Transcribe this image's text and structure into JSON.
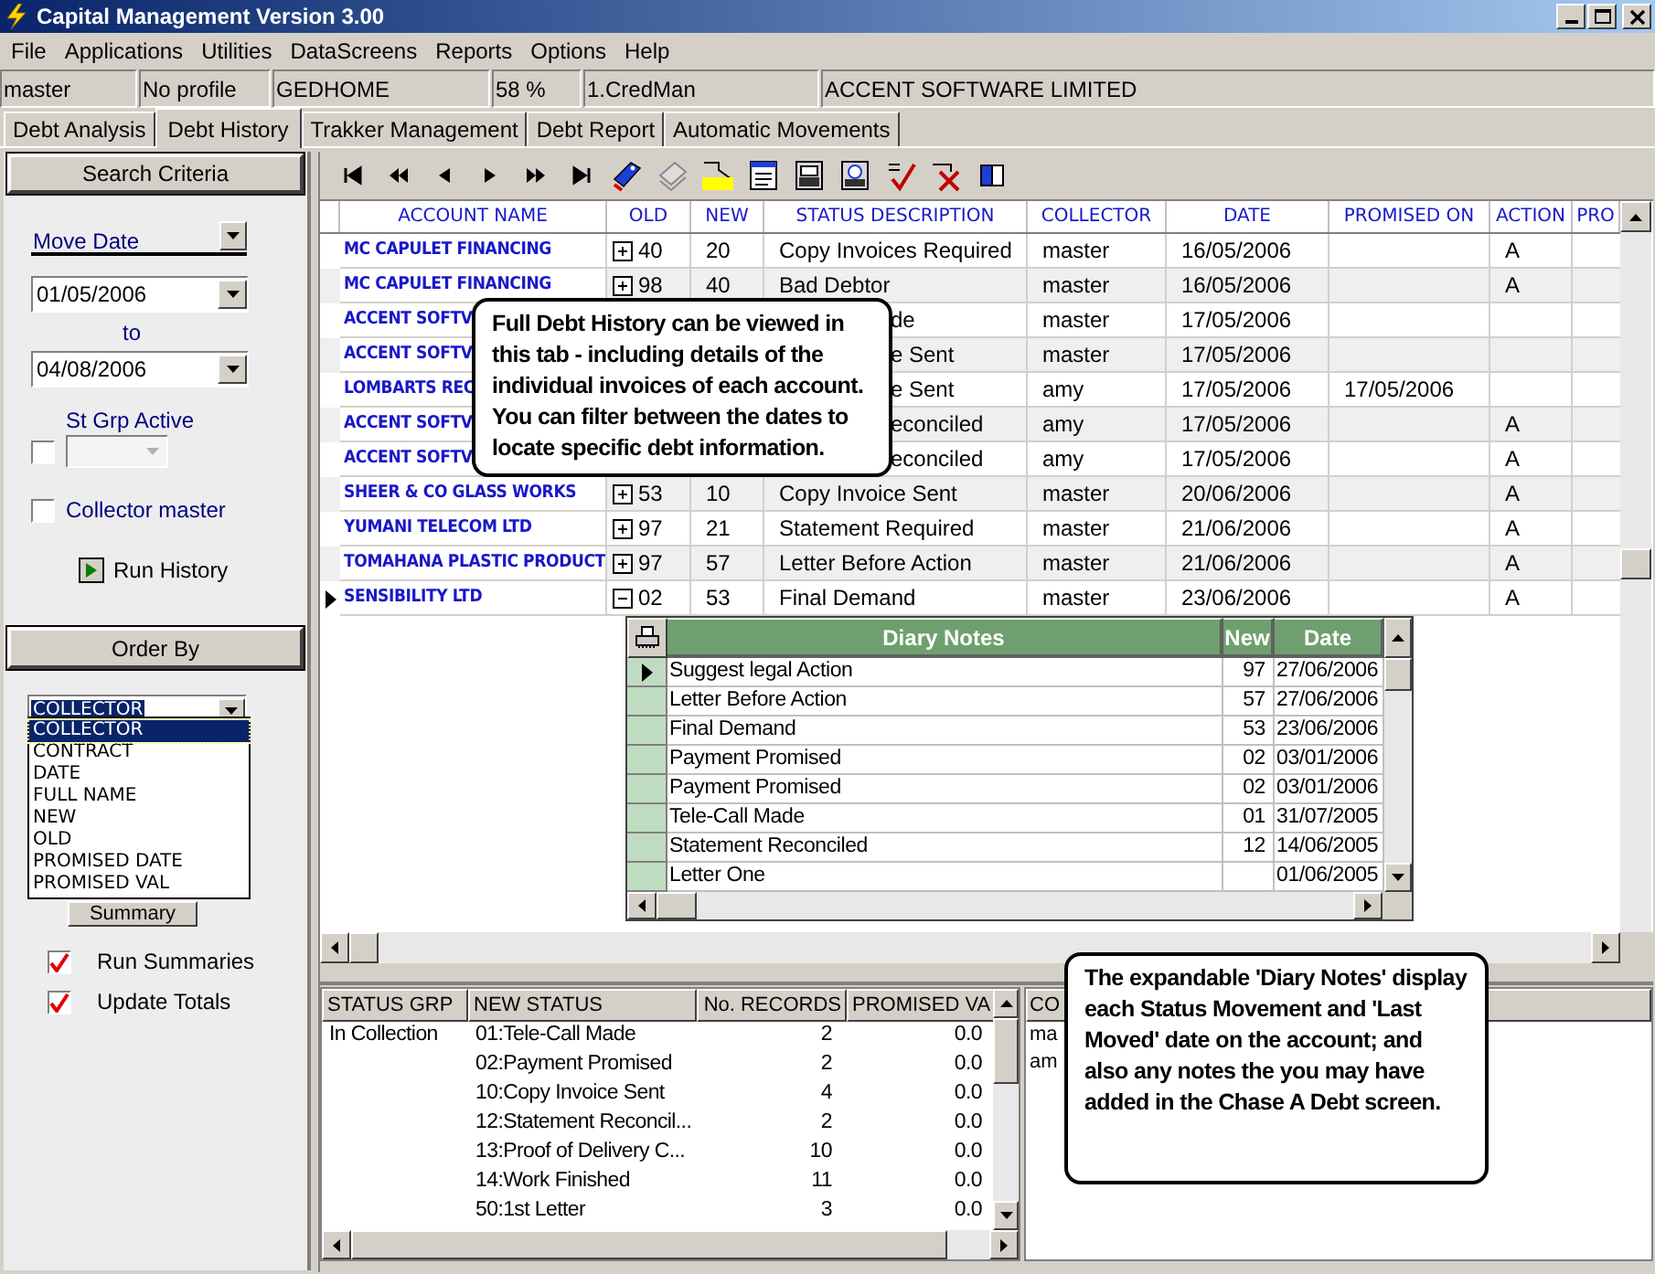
{
  "window": {
    "title": "Capital Management Version 3.00"
  },
  "menu": [
    "File",
    "Applications",
    "Utilities",
    "DataScreens",
    "Reports",
    "Options",
    "Help"
  ],
  "status_cells": [
    "master",
    "No profile",
    "GEDHOME",
    "58 %",
    "1.CredMan",
    "ACCENT SOFTWARE LIMITED"
  ],
  "tabs": [
    {
      "label": "Debt Analysis",
      "selected": false
    },
    {
      "label": "Debt History",
      "selected": true
    },
    {
      "label": "Trakker Management",
      "selected": false
    },
    {
      "label": "Debt Report",
      "selected": false
    },
    {
      "label": "Automatic Movements",
      "selected": false
    }
  ],
  "search_panel": {
    "title": "Search Criteria",
    "date_field": "Move Date",
    "from": "01/05/2006",
    "to_label": "to",
    "to": "04/08/2006",
    "status_group_label": "St Grp Active",
    "status_group_checked": false,
    "collector_label": "Collector master",
    "collector_checked": false,
    "run_button": "Run History"
  },
  "order_panel": {
    "title": "Order By",
    "value": "COLLECTOR",
    "options": [
      {
        "label": "COLLECTOR",
        "selected": true
      },
      {
        "label": "CONTRACT",
        "selected": false
      },
      {
        "label": "DATE",
        "selected": false
      },
      {
        "label": "FULL NAME",
        "selected": false
      },
      {
        "label": "NEW",
        "selected": false
      },
      {
        "label": "OLD",
        "selected": false
      },
      {
        "label": "PROMISED DATE",
        "selected": false
      },
      {
        "label": "PROMISED VAL",
        "selected": false
      }
    ],
    "summary_button": "Summary",
    "checks": [
      {
        "label": "Run Summaries",
        "checked": true
      },
      {
        "label": "Update Totals",
        "checked": true
      }
    ]
  },
  "grid": {
    "columns": [
      "ACCOUNT NAME",
      "OLD",
      "NEW",
      "STATUS DESCRIPTION",
      "COLLECTOR",
      "DATE",
      "PROMISED ON",
      "ACTION",
      "PRO"
    ],
    "rows": [
      {
        "kind": "full",
        "selected": false,
        "expanded": false,
        "account": "MC CAPULET FINANCING",
        "old": "40",
        "new": "20",
        "status": "Copy Invoices Required",
        "collector": "master",
        "date": "16/05/2006",
        "action": "A"
      },
      {
        "kind": "full",
        "selected": false,
        "expanded": false,
        "account": "MC CAPULET FINANCING",
        "old": "98",
        "new": "40",
        "status": "Bad Debtor",
        "collector": "master",
        "date": "16/05/2006",
        "action": "A"
      },
      {
        "kind": "covered",
        "selected": false,
        "account": "ACCENT SOFTV",
        "status": "de",
        "collector": "master",
        "date": "17/05/2006"
      },
      {
        "kind": "covered",
        "selected": false,
        "account": "ACCENT SOFTV",
        "status": "e Sent",
        "collector": "master",
        "date": "17/05/2006"
      },
      {
        "kind": "covered",
        "selected": false,
        "account": "LOMBARTS REC",
        "status": "e Sent",
        "collector": "amy",
        "date": "17/05/2006",
        "promised_on": "17/05/2006"
      },
      {
        "kind": "covered",
        "selected": false,
        "account": "ACCENT SOFTV",
        "status": "econciled",
        "collector": "amy",
        "date": "17/05/2006",
        "action": "A"
      },
      {
        "kind": "covered",
        "selected": false,
        "account": "ACCENT SOFTV",
        "status": "econciled",
        "collector": "amy",
        "date": "17/05/2006",
        "action": "A"
      },
      {
        "kind": "full",
        "selected": false,
        "expanded": false,
        "account": "SHEER & CO GLASS WORKS",
        "old": "53",
        "new": "10",
        "status": "Copy Invoice Sent",
        "collector": "master",
        "date": "20/06/2006",
        "action": "A"
      },
      {
        "kind": "full",
        "selected": false,
        "expanded": false,
        "account": "YUMANI TELECOM LTD",
        "old": "97",
        "new": "21",
        "status": "Statement Required",
        "collector": "master",
        "date": "21/06/2006",
        "action": "A"
      },
      {
        "kind": "full",
        "selected": false,
        "expanded": false,
        "account": "TOMAHANA PLASTIC PRODUCT",
        "old": "97",
        "new": "57",
        "status": "Letter Before Action",
        "collector": "master",
        "date": "21/06/2006",
        "action": "A"
      },
      {
        "kind": "full",
        "selected": true,
        "expanded": true,
        "account": "SENSIBILITY LTD",
        "old": "02",
        "new": "53",
        "status": "Final Demand",
        "collector": "master",
        "date": "23/06/2006",
        "action": "A"
      }
    ],
    "diary": {
      "columns": [
        "Diary Notes",
        "New",
        "Date"
      ],
      "rows": [
        {
          "selected": true,
          "note": "Suggest legal Action",
          "new": "97",
          "date": "27/06/2006"
        },
        {
          "selected": false,
          "note": "Letter Before Action",
          "new": "57",
          "date": "27/06/2006"
        },
        {
          "selected": false,
          "note": "Final Demand",
          "new": "53",
          "date": "23/06/2006"
        },
        {
          "selected": false,
          "note": "Payment Promised",
          "new": "02",
          "date": "03/01/2006"
        },
        {
          "selected": false,
          "note": "Payment Promised",
          "new": "02",
          "date": "03/01/2006"
        },
        {
          "selected": false,
          "note": "Tele-Call Made",
          "new": "01",
          "date": "31/07/2005"
        },
        {
          "selected": false,
          "note": "Statement Reconciled",
          "new": "12",
          "date": "14/06/2005"
        },
        {
          "selected": false,
          "note": "Letter One",
          "date": "01/06/2005"
        }
      ]
    }
  },
  "summary": {
    "columns": [
      "STATUS GRP",
      "NEW STATUS",
      "No. RECORDS",
      "PROMISED VA"
    ],
    "rows": [
      {
        "group": "In Collection",
        "status": "01:Tele-Call Made",
        "records": "2",
        "promised": "0.0"
      },
      {
        "status": "02:Payment Promised",
        "records": "2",
        "promised": "0.0"
      },
      {
        "status": "10:Copy Invoice Sent",
        "records": "4",
        "promised": "0.0"
      },
      {
        "status": "12:Statement Reconcil...",
        "records": "2",
        "promised": "0.0"
      },
      {
        "status": "13:Proof of Delivery C...",
        "records": "10",
        "promised": "0.0"
      },
      {
        "status": "14:Work Finished",
        "records": "11",
        "promised": "0.0"
      },
      {
        "status": "50:1st Letter",
        "records": "3",
        "promised": "0.0"
      }
    ]
  },
  "collector_panel": {
    "column": "CO",
    "rows": [
      "ma",
      "am"
    ]
  },
  "callouts": [
    "Full Debt History can be viewed in this tab - including details of the individual invoices of each account. You can filter between the dates to locate specific debt information.",
    "The expandable 'Diary Notes' display each Status Movement and 'Last Moved' date on the account; and also any notes the you may have added in the Chase A Debt screen."
  ]
}
